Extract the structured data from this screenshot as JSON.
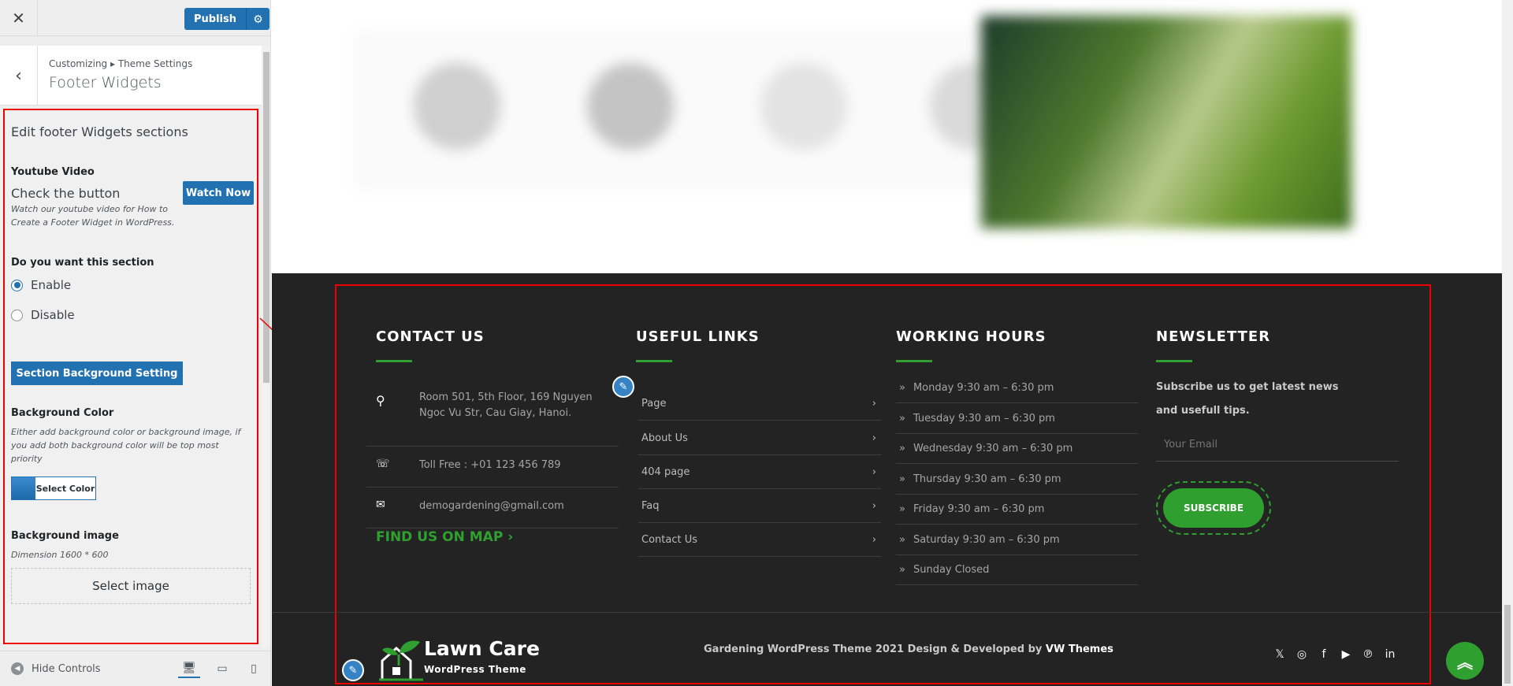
{
  "topbar": {
    "close": "✕",
    "publish": "Publish",
    "settings": "⚙"
  },
  "section": {
    "back": "‹",
    "breadcrumb": "Customizing ▸ Theme Settings",
    "title": "Footer Widgets"
  },
  "panel": {
    "title": "Edit footer Widgets sections",
    "youtube": {
      "label": "Youtube Video",
      "check": "Check the button",
      "button": "Watch Now",
      "desc": "Watch our youtube video for How to Create a Footer Widget in WordPress."
    },
    "want": {
      "label": "Do you want this section",
      "enable": "Enable",
      "disable": "Disable"
    },
    "bg_setting": "Section Background Setting",
    "bg_color": {
      "label": "Background Color",
      "desc": "Either add background color or background image, if you add both background color will be top most priority",
      "button": "Select Color"
    },
    "bg_image": {
      "label": "Background image",
      "desc": "Dimension 1600 * 600",
      "button": "Select image"
    }
  },
  "bottom": {
    "hide": "Hide Controls"
  },
  "footer": {
    "contact": {
      "title": "CONTACT US",
      "address": "Room 501, 5th Floor, 169 Nguyen Ngoc Vu Str, Cau Giay, Hanoi.",
      "phone": "Toll Free : +01 123 456 789",
      "email": "demogardening@gmail.com",
      "map": "FIND US ON MAP"
    },
    "links": {
      "title": "USEFUL LINKS",
      "items": [
        "Page",
        "About Us",
        "404 page",
        "Faq",
        "Contact Us"
      ]
    },
    "hours": {
      "title": "WORKING HOURS",
      "items": [
        "Monday 9:30 am – 6:30 pm",
        "Tuesday 9:30 am – 6:30 pm",
        "Wednesday 9:30 am – 6:30 pm",
        "Thursday 9:30 am – 6:30 pm",
        "Friday 9:30 am – 6:30 pm",
        "Saturday 9:30 am – 6:30 pm",
        "Sunday Closed"
      ]
    },
    "newsletter": {
      "title": "NEWSLETTER",
      "text": "Subscribe us to get latest news and usefull tips.",
      "placeholder": "Your Email",
      "button": "SUBSCRIBE"
    },
    "logo": {
      "name": "Lawn Care",
      "sub": "WordPress Theme"
    },
    "copyright": {
      "text": "Gardening WordPress Theme 2021 Design & Developed by",
      "brand": "VW Themes"
    }
  },
  "colors": {
    "accent": "#2fa02f",
    "wp_blue": "#2271b1",
    "footer_bg": "#232323",
    "outline": "#e00000"
  }
}
